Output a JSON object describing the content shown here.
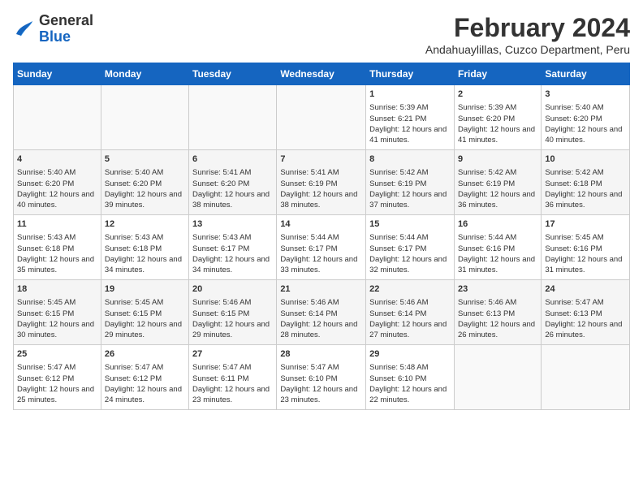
{
  "header": {
    "title": "February 2024",
    "location": "Andahuaylillas, Cuzco Department, Peru",
    "logo_general": "General",
    "logo_blue": "Blue"
  },
  "days_of_week": [
    "Sunday",
    "Monday",
    "Tuesday",
    "Wednesday",
    "Thursday",
    "Friday",
    "Saturday"
  ],
  "weeks": [
    [
      {
        "day": null,
        "info": null
      },
      {
        "day": null,
        "info": null
      },
      {
        "day": null,
        "info": null
      },
      {
        "day": null,
        "info": null
      },
      {
        "day": "1",
        "info": "Sunrise: 5:39 AM\nSunset: 6:21 PM\nDaylight: 12 hours and 41 minutes."
      },
      {
        "day": "2",
        "info": "Sunrise: 5:39 AM\nSunset: 6:20 PM\nDaylight: 12 hours and 41 minutes."
      },
      {
        "day": "3",
        "info": "Sunrise: 5:40 AM\nSunset: 6:20 PM\nDaylight: 12 hours and 40 minutes."
      }
    ],
    [
      {
        "day": "4",
        "info": "Sunrise: 5:40 AM\nSunset: 6:20 PM\nDaylight: 12 hours and 40 minutes."
      },
      {
        "day": "5",
        "info": "Sunrise: 5:40 AM\nSunset: 6:20 PM\nDaylight: 12 hours and 39 minutes."
      },
      {
        "day": "6",
        "info": "Sunrise: 5:41 AM\nSunset: 6:20 PM\nDaylight: 12 hours and 38 minutes."
      },
      {
        "day": "7",
        "info": "Sunrise: 5:41 AM\nSunset: 6:19 PM\nDaylight: 12 hours and 38 minutes."
      },
      {
        "day": "8",
        "info": "Sunrise: 5:42 AM\nSunset: 6:19 PM\nDaylight: 12 hours and 37 minutes."
      },
      {
        "day": "9",
        "info": "Sunrise: 5:42 AM\nSunset: 6:19 PM\nDaylight: 12 hours and 36 minutes."
      },
      {
        "day": "10",
        "info": "Sunrise: 5:42 AM\nSunset: 6:18 PM\nDaylight: 12 hours and 36 minutes."
      }
    ],
    [
      {
        "day": "11",
        "info": "Sunrise: 5:43 AM\nSunset: 6:18 PM\nDaylight: 12 hours and 35 minutes."
      },
      {
        "day": "12",
        "info": "Sunrise: 5:43 AM\nSunset: 6:18 PM\nDaylight: 12 hours and 34 minutes."
      },
      {
        "day": "13",
        "info": "Sunrise: 5:43 AM\nSunset: 6:17 PM\nDaylight: 12 hours and 34 minutes."
      },
      {
        "day": "14",
        "info": "Sunrise: 5:44 AM\nSunset: 6:17 PM\nDaylight: 12 hours and 33 minutes."
      },
      {
        "day": "15",
        "info": "Sunrise: 5:44 AM\nSunset: 6:17 PM\nDaylight: 12 hours and 32 minutes."
      },
      {
        "day": "16",
        "info": "Sunrise: 5:44 AM\nSunset: 6:16 PM\nDaylight: 12 hours and 31 minutes."
      },
      {
        "day": "17",
        "info": "Sunrise: 5:45 AM\nSunset: 6:16 PM\nDaylight: 12 hours and 31 minutes."
      }
    ],
    [
      {
        "day": "18",
        "info": "Sunrise: 5:45 AM\nSunset: 6:15 PM\nDaylight: 12 hours and 30 minutes."
      },
      {
        "day": "19",
        "info": "Sunrise: 5:45 AM\nSunset: 6:15 PM\nDaylight: 12 hours and 29 minutes."
      },
      {
        "day": "20",
        "info": "Sunrise: 5:46 AM\nSunset: 6:15 PM\nDaylight: 12 hours and 29 minutes."
      },
      {
        "day": "21",
        "info": "Sunrise: 5:46 AM\nSunset: 6:14 PM\nDaylight: 12 hours and 28 minutes."
      },
      {
        "day": "22",
        "info": "Sunrise: 5:46 AM\nSunset: 6:14 PM\nDaylight: 12 hours and 27 minutes."
      },
      {
        "day": "23",
        "info": "Sunrise: 5:46 AM\nSunset: 6:13 PM\nDaylight: 12 hours and 26 minutes."
      },
      {
        "day": "24",
        "info": "Sunrise: 5:47 AM\nSunset: 6:13 PM\nDaylight: 12 hours and 26 minutes."
      }
    ],
    [
      {
        "day": "25",
        "info": "Sunrise: 5:47 AM\nSunset: 6:12 PM\nDaylight: 12 hours and 25 minutes."
      },
      {
        "day": "26",
        "info": "Sunrise: 5:47 AM\nSunset: 6:12 PM\nDaylight: 12 hours and 24 minutes."
      },
      {
        "day": "27",
        "info": "Sunrise: 5:47 AM\nSunset: 6:11 PM\nDaylight: 12 hours and 23 minutes."
      },
      {
        "day": "28",
        "info": "Sunrise: 5:47 AM\nSunset: 6:10 PM\nDaylight: 12 hours and 23 minutes."
      },
      {
        "day": "29",
        "info": "Sunrise: 5:48 AM\nSunset: 6:10 PM\nDaylight: 12 hours and 22 minutes."
      },
      {
        "day": null,
        "info": null
      },
      {
        "day": null,
        "info": null
      }
    ]
  ]
}
